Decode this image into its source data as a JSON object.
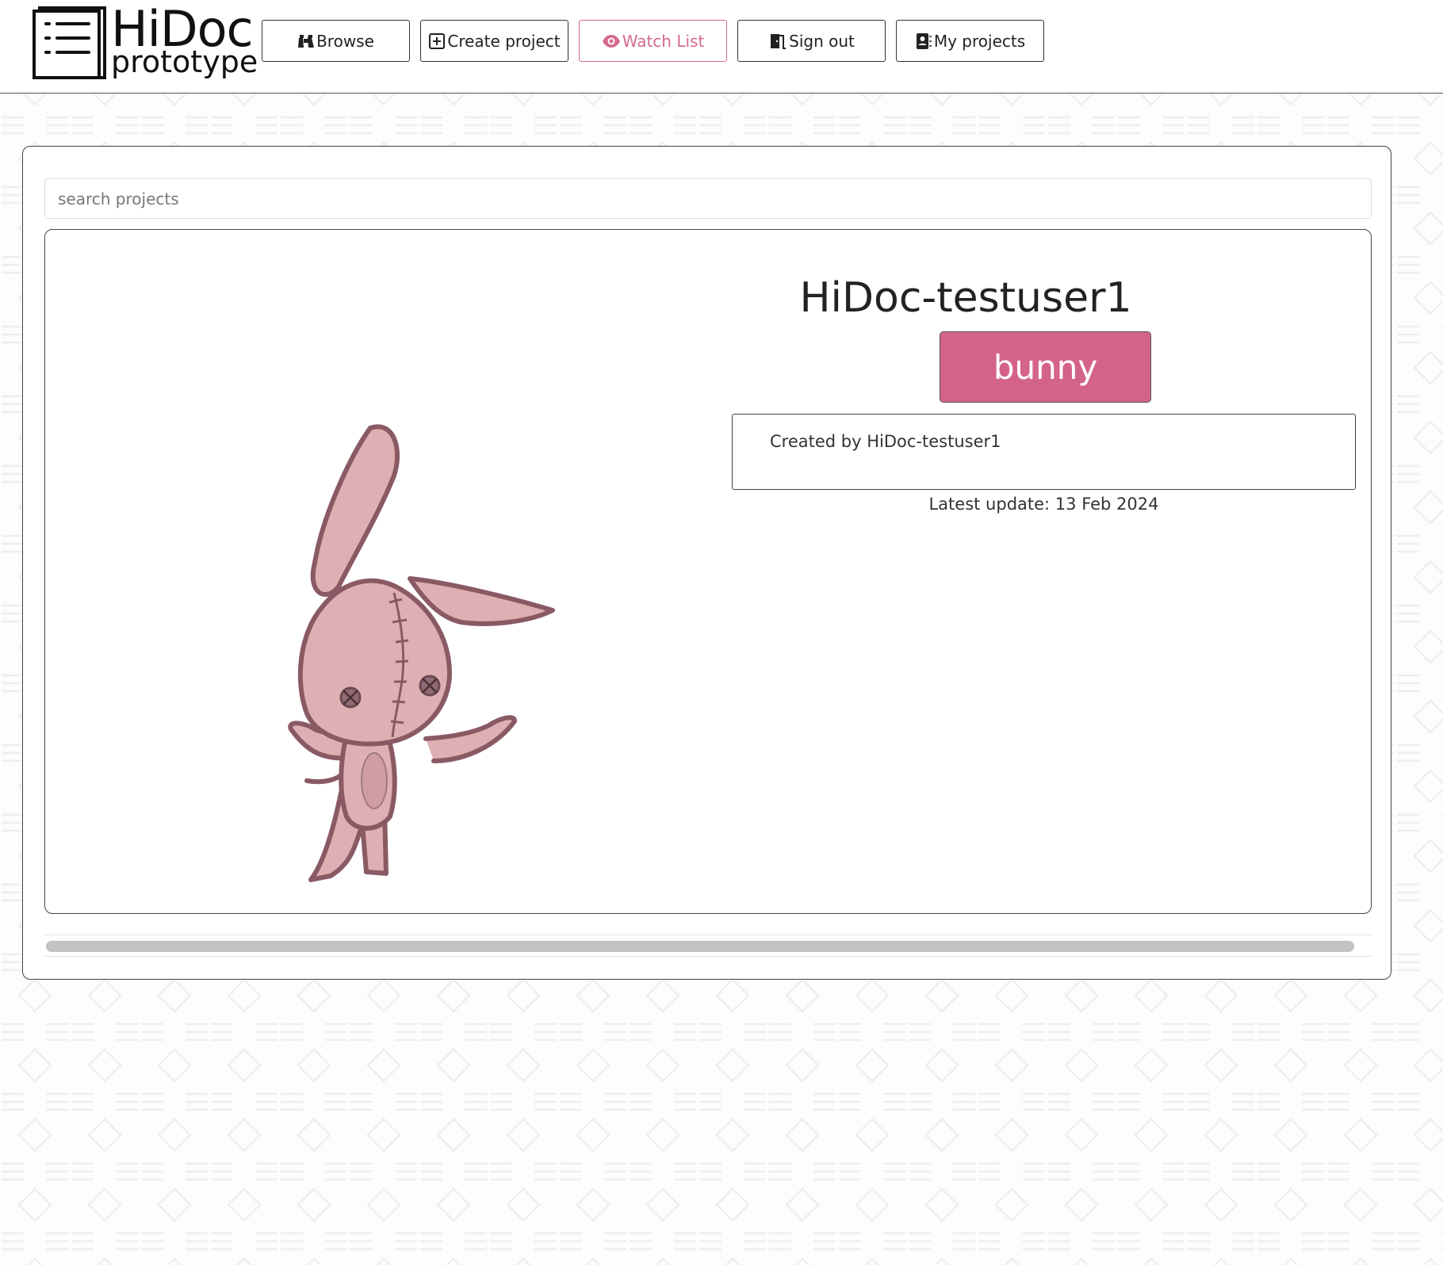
{
  "header": {
    "logo_title": "HiDoc",
    "logo_subtitle": "prototype",
    "nav": [
      {
        "label": "Browse",
        "icon": "binoculars-icon"
      },
      {
        "label": "Create project",
        "icon": "plus-square-icon"
      },
      {
        "label": "Watch List",
        "icon": "eye-icon",
        "active": true
      },
      {
        "label": "Sign out",
        "icon": "door-exit-icon"
      },
      {
        "label": "My projects",
        "icon": "contact-book-icon"
      }
    ]
  },
  "search": {
    "placeholder": "search projects",
    "value": ""
  },
  "project": {
    "title": "HiDoc-testuser1",
    "tag": "bunny",
    "created_by": "Created by HiDoc-testuser1",
    "latest_update": "Latest update: 13 Feb 2024",
    "image": "bunny-drawing"
  },
  "colors": {
    "accent": "#d46389",
    "active_nav": "#d46a8c",
    "border": "#444444"
  }
}
